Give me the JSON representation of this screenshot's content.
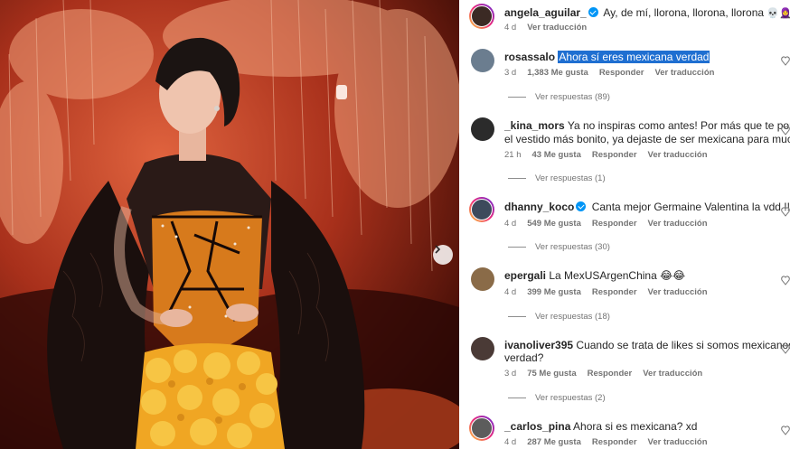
{
  "post": {
    "caption": {
      "username": "angela_aguilar_",
      "text": "Ay, de mí, llorona, llorona, llorona",
      "emojis": "💀🧕",
      "time": "4 d",
      "translate": "Ver traducción"
    }
  },
  "comments": [
    {
      "username": "rosassalo",
      "verified": false,
      "text": "Ahora sí eres mexicana verdad",
      "text2": "",
      "time": "3 d",
      "likes": "1,383 Me gusta",
      "reply": "Responder",
      "translate": "Ver traducción",
      "replies": "Ver respuestas (89)",
      "avatar_color": "#6b7d8f"
    },
    {
      "username": "_kina_mors",
      "verified": false,
      "text": "Ya no inspiras como antes! Por más que te pongas",
      "text2": "el vestido más bonito, ya dejaste de ser mexicana para muchos",
      "time": "21 h",
      "likes": "43 Me gusta",
      "reply": "Responder",
      "translate": "Ver traducción",
      "replies": "Ver respuestas (1)",
      "avatar_color": "#2b2b2b"
    },
    {
      "username": "dhanny_koco",
      "verified": true,
      "text": "Canta mejor Germaine Valentina la vdd !!",
      "text2": "",
      "time": "4 d",
      "likes": "549 Me gusta",
      "reply": "Responder",
      "translate": "Ver traducción",
      "replies": "Ver respuestas (30)",
      "avatar_color": "#3d4a5c"
    },
    {
      "username": "epergali",
      "verified": false,
      "text": "La MexUSArgenChina 😂😂",
      "text2": "",
      "time": "4 d",
      "likes": "399 Me gusta",
      "reply": "Responder",
      "translate": "Ver traducción",
      "replies": "Ver respuestas (18)",
      "avatar_color": "#8a6b48"
    },
    {
      "username": "ivanoliver395",
      "verified": false,
      "text": "Cuando se trata de likes si somos mexicanos",
      "text2": "verdad?",
      "time": "3 d",
      "likes": "75 Me gusta",
      "reply": "Responder",
      "translate": "Ver traducción",
      "replies": "Ver respuestas (2)",
      "avatar_color": "#4a3a36"
    },
    {
      "username": "_carlos_pina",
      "verified": false,
      "text": "Ahora si es mexicana? xd",
      "text2": "",
      "time": "4 d",
      "likes": "287 Me gusta",
      "reply": "Responder",
      "translate": "Ver traducción",
      "replies": "",
      "avatar_color": "#5c5c5c"
    }
  ],
  "colors": {
    "accent": "#0095f6",
    "highlight": "#1f6fd1",
    "muted": "#737373"
  }
}
